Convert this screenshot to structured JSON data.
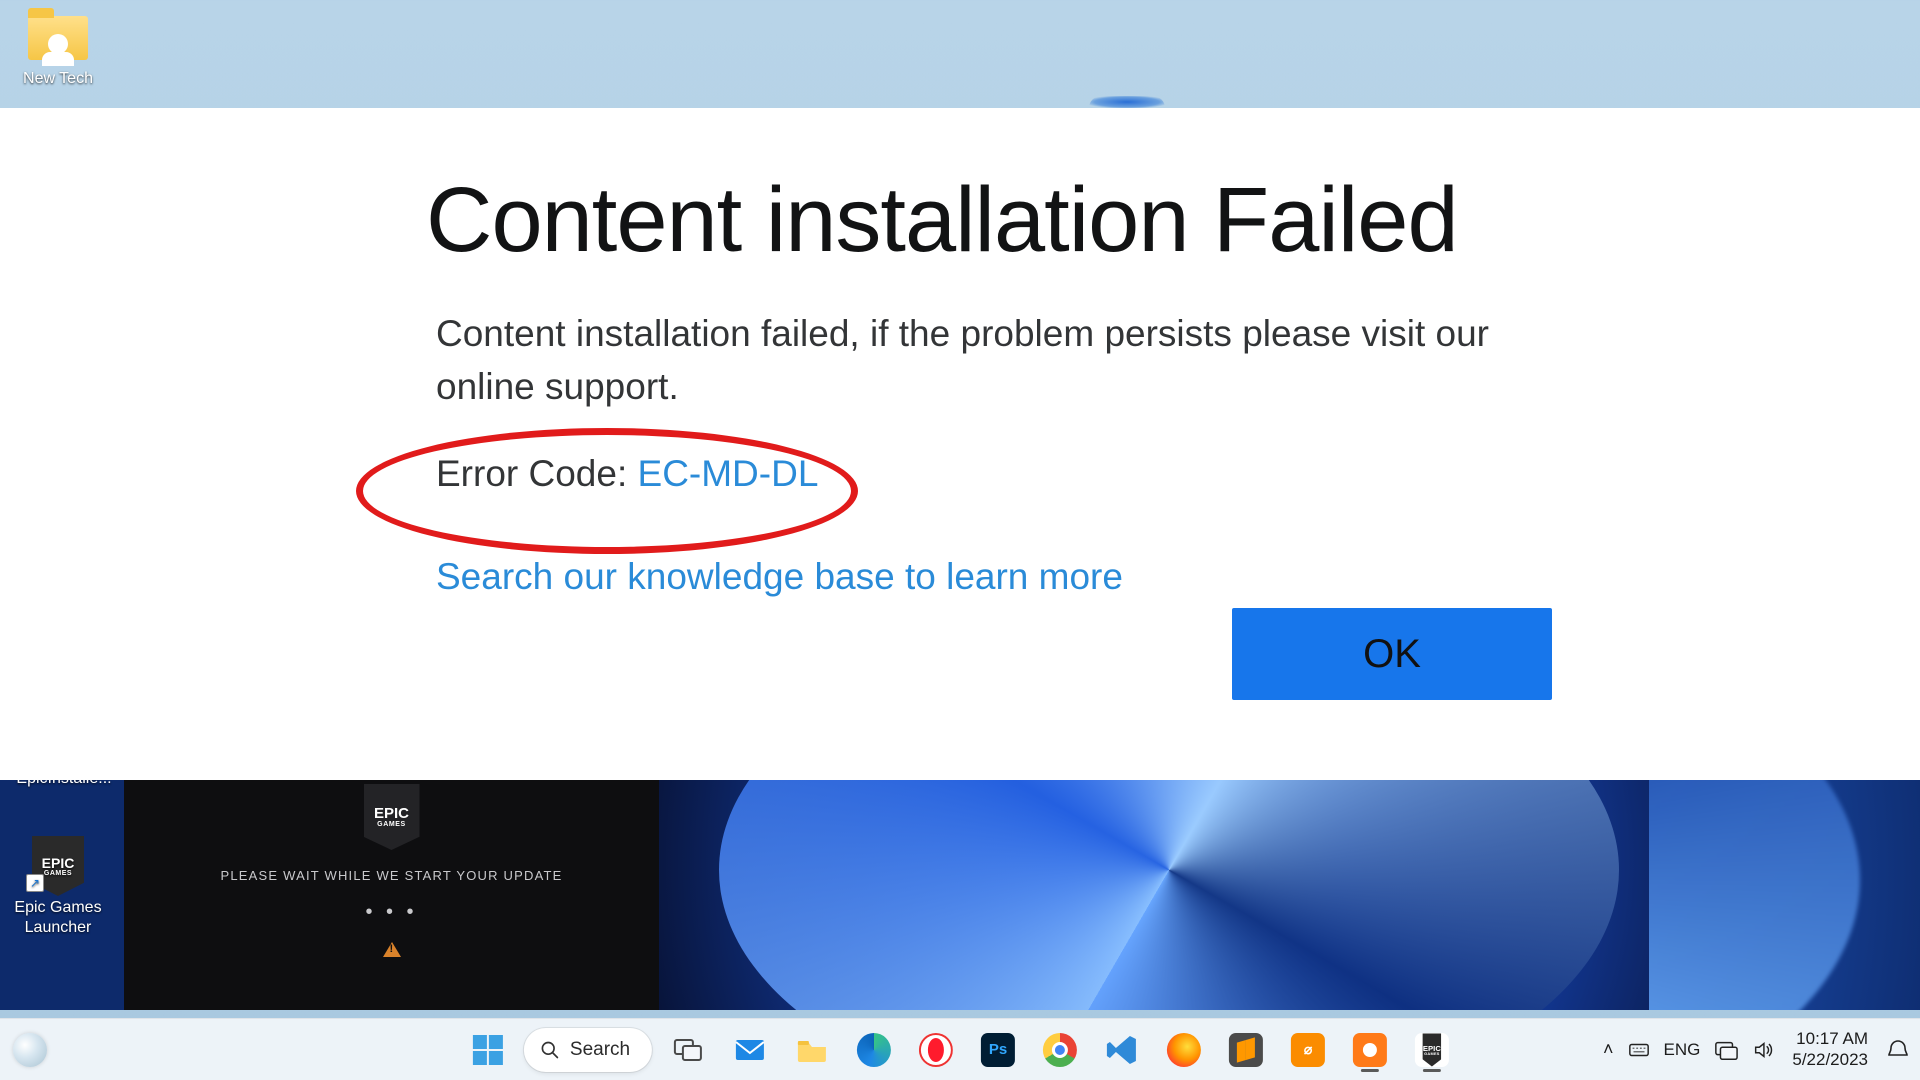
{
  "desktop": {
    "icons": {
      "new_tech": "New Tech",
      "epic_installer": "EpicInstalle...",
      "epic_launcher": "Epic Games Launcher"
    }
  },
  "dialog": {
    "title": "Content installation Failed",
    "body": "Content installation failed, if the problem persists please visit our online support.",
    "error_label": "Error Code: ",
    "error_code": "EC-MD-DL",
    "kb_link": "Search our knowledge base to learn more",
    "ok_label": "OK"
  },
  "epic_updater": {
    "brand_top": "EPIC",
    "brand_bottom": "GAMES",
    "status": "PLEASE WAIT WHILE WE START YOUR UPDATE",
    "dots": "• • •"
  },
  "taskbar": {
    "search_label": "Search",
    "lang": "ENG",
    "time": "10:17 AM",
    "date": "5/22/2023"
  }
}
